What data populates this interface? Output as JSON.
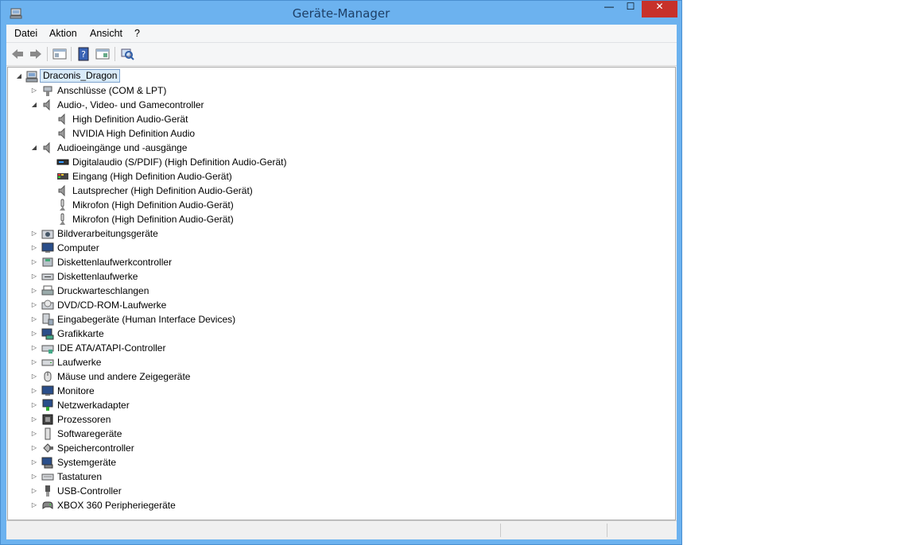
{
  "window": {
    "title": "Geräte-Manager",
    "close_glyph": "✕",
    "min_glyph": "—",
    "max_glyph": "☐"
  },
  "menu": [
    {
      "label": "Datei"
    },
    {
      "label": "Aktion"
    },
    {
      "label": "Ansicht"
    },
    {
      "label": "?"
    }
  ],
  "toolbar": [
    {
      "icon": "back-arrow-icon"
    },
    {
      "icon": "forward-arrow-icon"
    },
    {
      "icon": "show-hide-tree-icon"
    },
    {
      "icon": "help-icon"
    },
    {
      "icon": "properties-icon"
    },
    {
      "icon": "scan-hardware-icon"
    }
  ],
  "tree": {
    "root": {
      "label": "Draconis_Dragon",
      "icon": "computer-icon",
      "expanded": true
    },
    "items": [
      {
        "label": "Anschlüsse (COM & LPT)",
        "icon": "port-icon",
        "expanded": false,
        "level": 1
      },
      {
        "label": "Audio-, Video- und Gamecontroller",
        "icon": "speaker-icon",
        "expanded": true,
        "level": 1
      },
      {
        "label": "High Definition Audio-Gerät",
        "icon": "speaker-icon",
        "level": 2
      },
      {
        "label": "NVIDIA High Definition Audio",
        "icon": "speaker-icon",
        "level": 2
      },
      {
        "label": "Audioeingänge und -ausgänge",
        "icon": "speaker-icon",
        "expanded": true,
        "level": 1
      },
      {
        "label": "Digitalaudio (S/PDIF) (High Definition Audio-Gerät)",
        "icon": "spdif-icon",
        "level": 2
      },
      {
        "label": "Eingang (High Definition Audio-Gerät)",
        "icon": "audio-input-icon",
        "level": 2
      },
      {
        "label": "Lautsprecher (High Definition Audio-Gerät)",
        "icon": "speaker-icon",
        "level": 2
      },
      {
        "label": "Mikrofon (High Definition Audio-Gerät)",
        "icon": "microphone-icon",
        "level": 2
      },
      {
        "label": "Mikrofon (High Definition Audio-Gerät)",
        "icon": "microphone-icon",
        "level": 2
      },
      {
        "label": "Bildverarbeitungsgeräte",
        "icon": "camera-icon",
        "expanded": false,
        "level": 1
      },
      {
        "label": "Computer",
        "icon": "monitor-icon",
        "expanded": false,
        "level": 1
      },
      {
        "label": "Diskettenlaufwerkcontroller",
        "icon": "floppy-controller-icon",
        "expanded": false,
        "level": 1
      },
      {
        "label": "Diskettenlaufwerke",
        "icon": "floppy-drive-icon",
        "expanded": false,
        "level": 1
      },
      {
        "label": "Druckwarteschlangen",
        "icon": "printer-icon",
        "expanded": false,
        "level": 1
      },
      {
        "label": "DVD/CD-ROM-Laufwerke",
        "icon": "disc-drive-icon",
        "expanded": false,
        "level": 1
      },
      {
        "label": "Eingabegeräte (Human Interface Devices)",
        "icon": "hid-icon",
        "expanded": false,
        "level": 1
      },
      {
        "label": "Grafikkarte",
        "icon": "display-adapter-icon",
        "expanded": false,
        "level": 1
      },
      {
        "label": "IDE ATA/ATAPI-Controller",
        "icon": "ide-controller-icon",
        "expanded": false,
        "level": 1
      },
      {
        "label": "Laufwerke",
        "icon": "disk-drive-icon",
        "expanded": false,
        "level": 1
      },
      {
        "label": "Mäuse und andere Zeigegeräte",
        "icon": "mouse-icon",
        "expanded": false,
        "level": 1
      },
      {
        "label": "Monitore",
        "icon": "monitor-icon",
        "expanded": false,
        "level": 1
      },
      {
        "label": "Netzwerkadapter",
        "icon": "network-adapter-icon",
        "expanded": false,
        "level": 1
      },
      {
        "label": "Prozessoren",
        "icon": "processor-icon",
        "expanded": false,
        "level": 1
      },
      {
        "label": "Softwaregeräte",
        "icon": "software-device-icon",
        "expanded": false,
        "level": 1
      },
      {
        "label": "Speichercontroller",
        "icon": "storage-controller-icon",
        "expanded": false,
        "level": 1
      },
      {
        "label": "Systemgeräte",
        "icon": "system-device-icon",
        "expanded": false,
        "level": 1
      },
      {
        "label": "Tastaturen",
        "icon": "keyboard-icon",
        "expanded": false,
        "level": 1
      },
      {
        "label": "USB-Controller",
        "icon": "usb-icon",
        "expanded": false,
        "level": 1
      },
      {
        "label": "XBOX 360 Peripheriegeräte",
        "icon": "gamepad-icon",
        "expanded": false,
        "level": 1
      }
    ]
  },
  "colors": {
    "title_bar": "#6cb2ef",
    "close_button": "#c7312a",
    "selection": "#d9ebf9"
  }
}
